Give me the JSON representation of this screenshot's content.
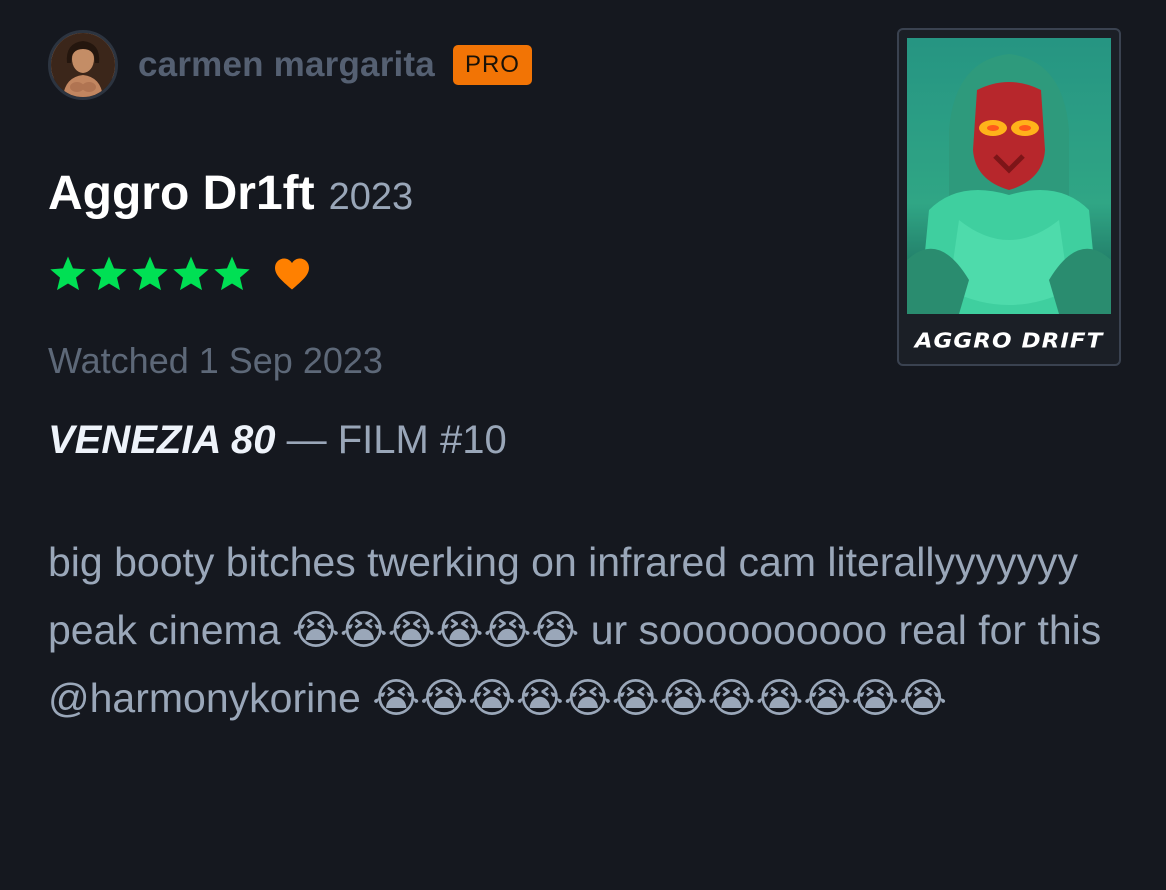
{
  "user": {
    "display_name": "carmen margarita",
    "badge": "PRO",
    "avatar_icon": "avatar-photo"
  },
  "film": {
    "title": "Aggro Dr1ft",
    "year": "2023",
    "poster_caption": "AGGRO DRIFT"
  },
  "rating": {
    "stars": 5,
    "max_stars": 5,
    "star_color": "#00e054",
    "liked": true,
    "like_color": "#ff8000"
  },
  "watched": {
    "label": "Watched 1 Sep 2023"
  },
  "list_tag": {
    "name": "VENEZIA 80",
    "separator": " — ",
    "number": "FILM #10"
  },
  "review": {
    "text": "big booty bitches twerking on infrared cam literallyyyyyyy peak cinema 😭😭😭😭😭😭 ur soooooooooo real for this @harmonykorine 😭😭😭😭😭😭😭😭😭😭😭😭"
  },
  "colors": {
    "background": "#15181f",
    "username": "#556072",
    "badge_bg": "#f27405",
    "title": "#ffffff",
    "muted": "#99a6b8",
    "body_text": "#9aa7b9"
  }
}
